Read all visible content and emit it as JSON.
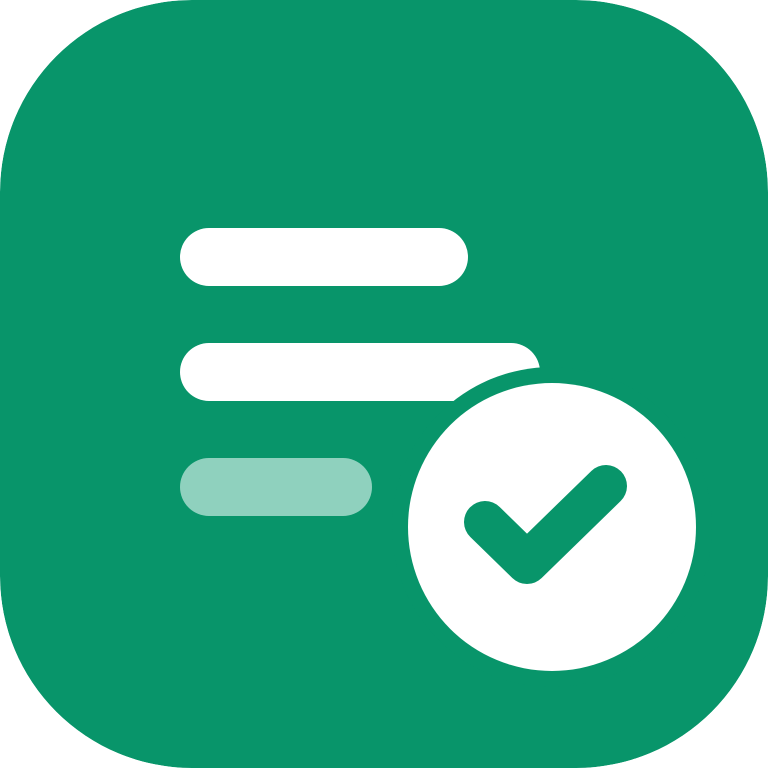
{
  "app_icon": {
    "icon_name": "checklist-approved-icon",
    "colors": {
      "background": "#08956A",
      "foreground": "#FFFFFF",
      "muted_line": "#8FD1BE",
      "check_mark": "#08956A"
    },
    "list_lines": [
      {
        "name": "list-line-1",
        "style": "solid"
      },
      {
        "name": "list-line-2",
        "style": "solid"
      },
      {
        "name": "list-line-3",
        "style": "muted"
      }
    ],
    "badge": {
      "icon_name": "check-icon",
      "state": "checked"
    }
  }
}
